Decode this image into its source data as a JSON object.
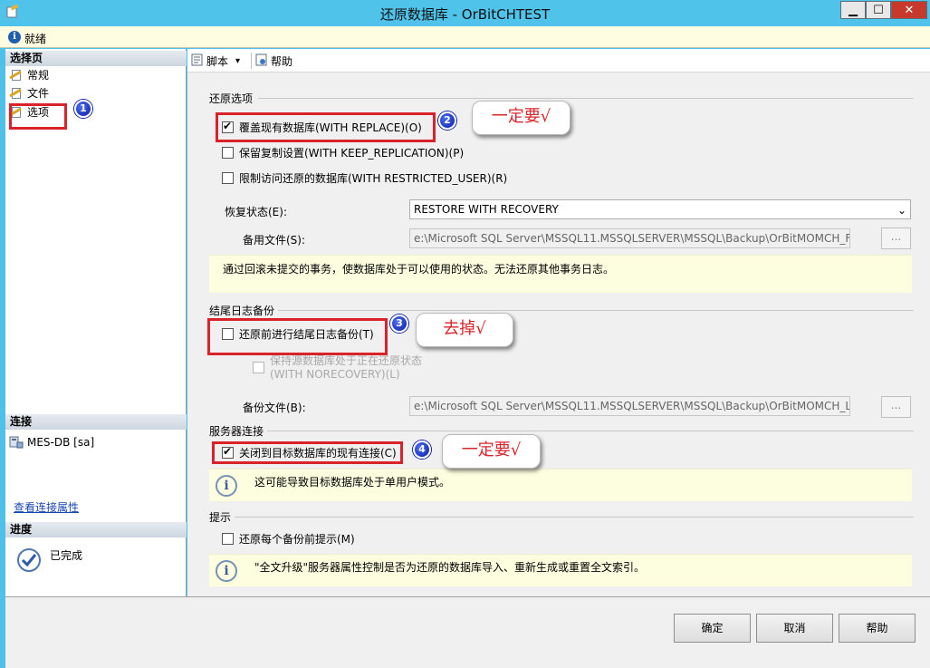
{
  "window": {
    "title": "还原数据库 - OrBitCHTEST",
    "min": "▁",
    "max": "☐",
    "close": "✕"
  },
  "status": {
    "icon": "info-icon",
    "text": "就绪"
  },
  "left": {
    "select_page_header": "选择页",
    "pages": [
      {
        "label": "常规"
      },
      {
        "label": "文件"
      },
      {
        "label": "选项"
      }
    ],
    "connection_header": "连接",
    "connection_name": "MES-DB [sa]",
    "view_connection_link": "查看连接属性",
    "progress_header": "进度",
    "progress_status": "已完成"
  },
  "toolbar": {
    "script_label": "脚本",
    "script_arrow": "▾",
    "help_label": "帮助"
  },
  "restore_options": {
    "title": "还原选项",
    "overwrite": {
      "label": "覆盖现有数据库(WITH REPLACE)(O)",
      "checked": true
    },
    "keep_replication": {
      "label": "保留复制设置(WITH KEEP_REPLICATION)(P)",
      "checked": false
    },
    "restricted_user": {
      "label": "限制访问还原的数据库(WITH RESTRICTED_USER)(R)",
      "checked": false
    },
    "recovery_state_label": "恢复状态(E):",
    "recovery_state_value": "RESTORE WITH RECOVERY",
    "standby_file_label": "备用文件(S):",
    "standby_file_value": "e:\\Microsoft SQL Server\\MSSQL11.MSSQLSERVER\\MSSQL\\Backup\\OrBitMOMCH_F",
    "browse": "...",
    "description": "通过回滚未提交的事务，使数据库处于可以使用的状态。无法还原其他事务日志。"
  },
  "tail_log": {
    "title": "结尾日志备份",
    "take_tail_log": {
      "label": "还原前进行结尾日志备份(T)",
      "checked": false
    },
    "leave_restoring_line1": "保持源数据库处于正在还原状态",
    "leave_restoring_line2": "(WITH NORECOVERY)(L)",
    "backup_file_label": "备份文件(B):",
    "backup_file_value": "e:\\Microsoft SQL Server\\MSSQL11.MSSQLSERVER\\MSSQL\\Backup\\OrBitMOMCH_L",
    "browse": "..."
  },
  "server_connections": {
    "title": "服务器连接",
    "close_existing": {
      "label": "关闭到目标数据库的现有连接(C)",
      "checked": true
    },
    "note": "这可能导致目标数据库处于单用户模式。"
  },
  "prompt": {
    "title": "提示",
    "prompt_each": {
      "label": "还原每个备份前提示(M)",
      "checked": false
    },
    "note": "\"全文升级\"服务器属性控制是否为还原的数据库导入、重新生成或重置全文索引。"
  },
  "buttons": {
    "ok": "确定",
    "cancel": "取消",
    "help": "帮助"
  },
  "annotations": {
    "badges": [
      "1",
      "2",
      "3",
      "4"
    ],
    "callout_2": "一定要√",
    "callout_3": "去掉√",
    "callout_4": "一定要√",
    "highlight_color": "#d9222a"
  }
}
